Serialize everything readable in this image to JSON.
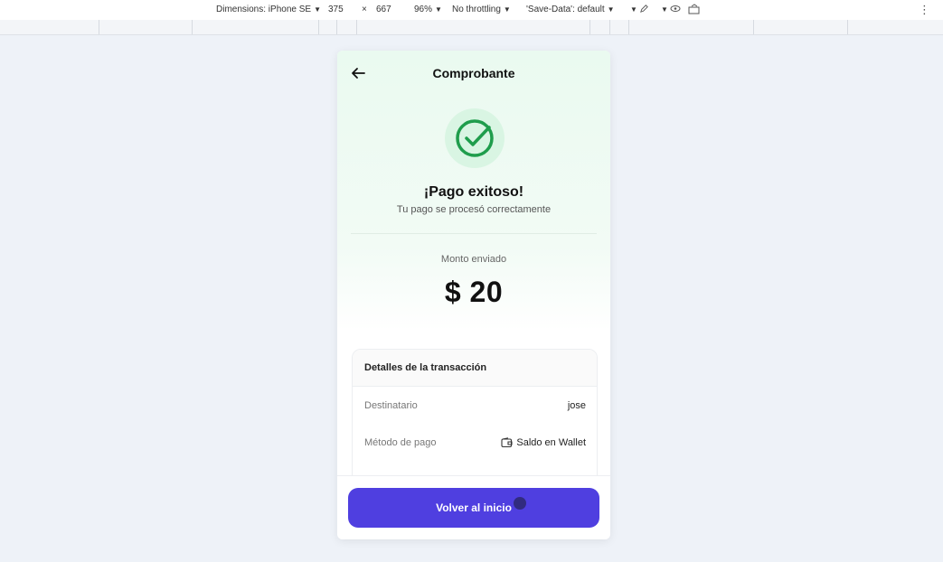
{
  "devtools": {
    "device_label": "Dimensions: iPhone SE",
    "width": "375",
    "times": "×",
    "height": "667",
    "zoom": "96%",
    "throttling": "No throttling",
    "save_data": "'Save-Data': default"
  },
  "screen": {
    "title": "Comprobante",
    "success_title": "¡Pago exitoso!",
    "success_subtitle": "Tu pago se procesó correctamente",
    "amount_label": "Monto enviado",
    "amount": "$ 20",
    "details": {
      "heading": "Detalles de la transacción",
      "rows": [
        {
          "label": "Destinatario",
          "value": "jose"
        },
        {
          "label": "Método de pago",
          "value": "Saldo en Wallet"
        }
      ]
    },
    "primary_button": "Volver al inicio"
  },
  "colors": {
    "accent": "#4f3fe0",
    "success": "#1f9d4c",
    "success_bg": "#d9f5e3"
  }
}
